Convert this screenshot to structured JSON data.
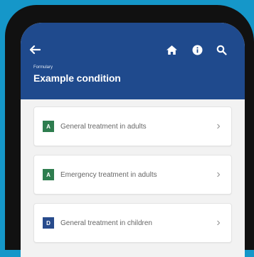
{
  "appbar": {
    "breadcrumb": "Formulary",
    "title": "Example condition"
  },
  "icons": {
    "back": "arrow-left-icon",
    "home": "home-icon",
    "info": "info-icon",
    "search": "search-icon",
    "chevron": "chevron-right-icon"
  },
  "items": [
    {
      "badge": "A",
      "label": "General treatment in adults",
      "color": "#2e7d4f"
    },
    {
      "badge": "A",
      "label": "Emergency treatment in adults",
      "color": "#2e7d4f"
    },
    {
      "badge": "D",
      "label": "General treatment in children",
      "color": "#284b8c"
    }
  ],
  "colors": {
    "background": "#1597c9",
    "appbar": "#1f4a8d",
    "badge_adult": "#2e7d4f",
    "badge_child": "#284b8c"
  }
}
